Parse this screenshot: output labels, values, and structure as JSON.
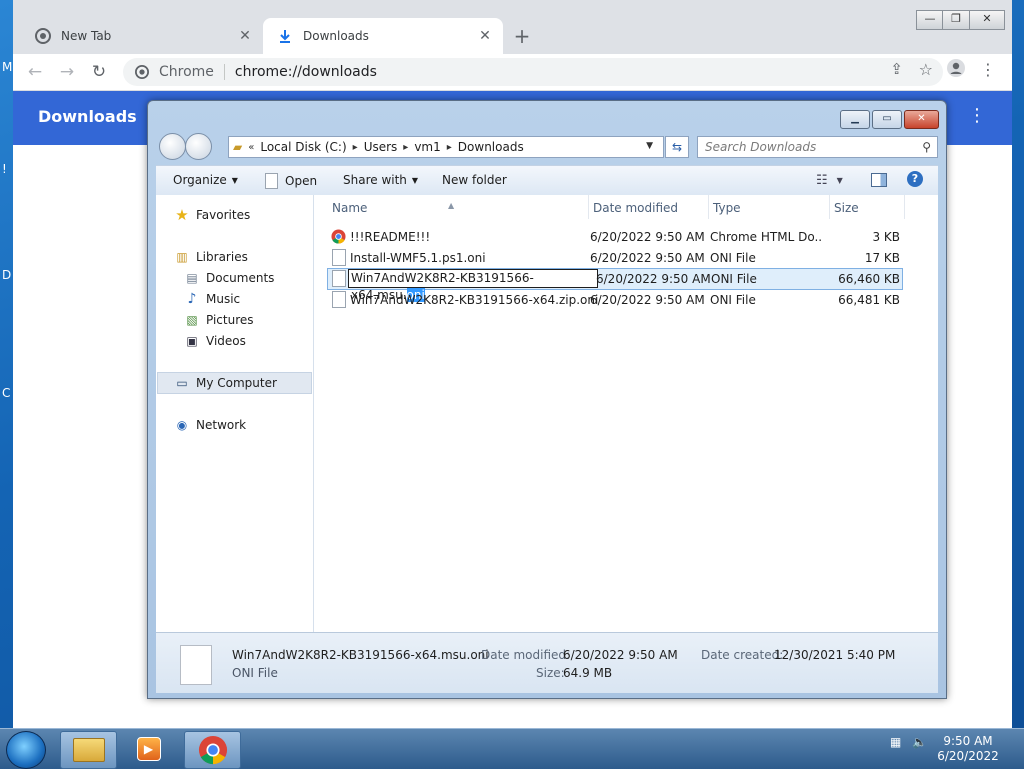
{
  "chrome": {
    "tabs": [
      {
        "label": "New Tab",
        "icon": "chrome-icon"
      },
      {
        "label": "Downloads",
        "icon": "download-icon"
      }
    ],
    "omnibox": {
      "site": "Chrome",
      "url": "chrome://downloads"
    },
    "page_title": "Downloads"
  },
  "explorer": {
    "breadcrumb": [
      "Local Disk (C:)",
      "Users",
      "vm1",
      "Downloads"
    ],
    "search_placeholder": "Search Downloads",
    "commands": {
      "organize": "Organize",
      "open": "Open",
      "share_with": "Share with",
      "new_folder": "New folder"
    },
    "nav": {
      "favorites": "Favorites",
      "libraries": "Libraries",
      "documents": "Documents",
      "music": "Music",
      "pictures": "Pictures",
      "videos": "Videos",
      "my_computer": "My Computer",
      "network": "Network"
    },
    "columns": {
      "name": "Name",
      "date": "Date modified",
      "type": "Type",
      "size": "Size"
    },
    "files": [
      {
        "name": "!!!README!!!",
        "date": "6/20/2022 9:50 AM",
        "type": "Chrome HTML Do...",
        "size": "3 KB"
      },
      {
        "name": "Install-WMF5.1.ps1.oni",
        "date": "6/20/2022 9:50 AM",
        "type": "ONI File",
        "size": "17 KB"
      },
      {
        "name_base": "Win7AndW2K8R2-KB3191566-x64.msu.",
        "name_ext": "oni",
        "date": "6/20/2022 9:50 AM",
        "type": "ONI File",
        "size": "66,460 KB"
      },
      {
        "name": "Win7AndW2K8R2-KB3191566-x64.zip.oni",
        "date": "6/20/2022 9:50 AM",
        "type": "ONI File",
        "size": "66,481 KB"
      }
    ],
    "details": {
      "filename": "Win7AndW2K8R2-KB3191566-x64.msu.oni",
      "filetype": "ONI File",
      "date_modified_label": "Date modified:",
      "date_modified": "6/20/2022 9:50 AM",
      "date_created_label": "Date created:",
      "date_created": "12/30/2021 5:40 PM",
      "size_label": "Size:",
      "size": "64.9 MB"
    }
  },
  "taskbar": {
    "time": "9:50 AM",
    "date": "6/20/2022"
  }
}
